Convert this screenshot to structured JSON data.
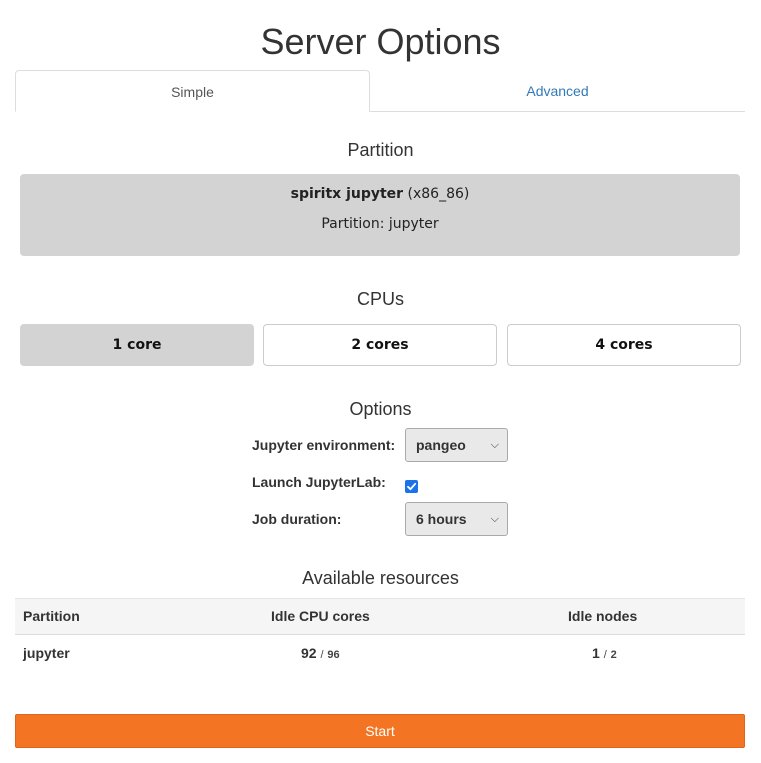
{
  "header": {
    "title": "Server Options"
  },
  "tabs": [
    {
      "label": "Simple",
      "active": true
    },
    {
      "label": "Advanced",
      "active": false
    }
  ],
  "partition_section": {
    "title": "Partition",
    "card": {
      "name": "spiritx jupyter",
      "arch": "(x86_86)",
      "partition_line": "Partition: jupyter"
    }
  },
  "cpus_section": {
    "title": "CPUs",
    "options": [
      {
        "label": "1 core",
        "selected": true
      },
      {
        "label": "2 cores",
        "selected": false
      },
      {
        "label": "4 cores",
        "selected": false
      }
    ]
  },
  "options_section": {
    "title": "Options",
    "jupyter_environment": {
      "label": "Jupyter environment:",
      "value": "pangeo"
    },
    "launch_jupyterlab": {
      "label": "Launch JupyterLab:",
      "checked": true
    },
    "job_duration": {
      "label": "Job duration:",
      "value": "6 hours"
    }
  },
  "resources_section": {
    "title": "Available resources",
    "columns": [
      "Partition",
      "Idle CPU cores",
      "Idle nodes"
    ],
    "rows": [
      {
        "partition": "jupyter",
        "idle_cpu": "92",
        "total_cpu": "96",
        "idle_nodes": "1",
        "total_nodes": "2"
      }
    ],
    "separator": "/"
  },
  "actions": {
    "start_label": "Start"
  },
  "colors": {
    "accent": "#f37524",
    "link": "#337ab7",
    "selected": "#d3d3d3",
    "checkbox": "#1a73e8"
  }
}
